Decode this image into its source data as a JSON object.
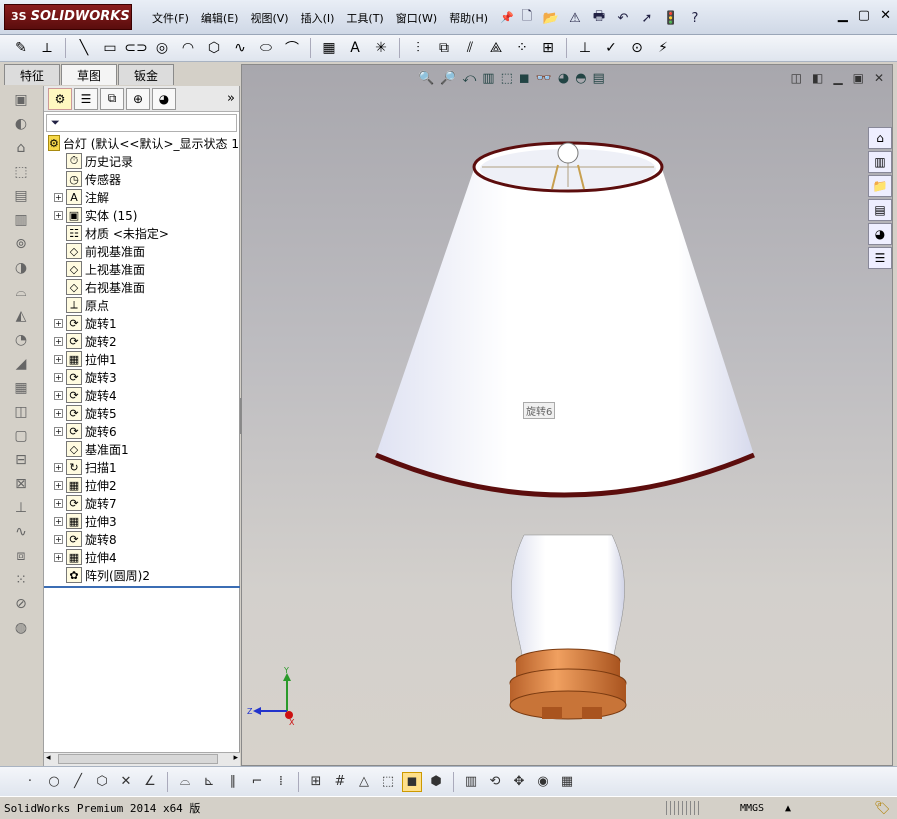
{
  "app": {
    "logo_prefix": "3S",
    "logo_text": "SOLIDWORKS",
    "menus": [
      "文件(F)",
      "编辑(E)",
      "视图(V)",
      "插入(I)",
      "工具(T)",
      "窗口(W)",
      "帮助(H)"
    ]
  },
  "tabs": [
    "特征",
    "草图",
    "钣金"
  ],
  "active_tab": "草图",
  "feature_tree": {
    "root_label": "台灯  (默认<<默认>_显示状态 1",
    "items": [
      {
        "label": "历史记录",
        "icon": "history-icon",
        "expandable": false
      },
      {
        "label": "传感器",
        "icon": "sensor-icon",
        "expandable": false
      },
      {
        "label": "注解",
        "icon": "annotation-icon",
        "expandable": true
      },
      {
        "label": "实体 (15)",
        "icon": "solid-bodies-icon",
        "expandable": true
      },
      {
        "label": "材质 <未指定>",
        "icon": "material-icon",
        "expandable": false
      },
      {
        "label": "前视基准面",
        "icon": "plane-icon",
        "expandable": false
      },
      {
        "label": "上视基准面",
        "icon": "plane-icon",
        "expandable": false
      },
      {
        "label": "右视基准面",
        "icon": "plane-icon",
        "expandable": false
      },
      {
        "label": "原点",
        "icon": "origin-icon",
        "expandable": false
      },
      {
        "label": "旋转1",
        "icon": "revolve-icon",
        "expandable": true
      },
      {
        "label": "旋转2",
        "icon": "revolve-icon",
        "expandable": true
      },
      {
        "label": "拉伸1",
        "icon": "extrude-icon",
        "expandable": true
      },
      {
        "label": "旋转3",
        "icon": "revolve-icon",
        "expandable": true
      },
      {
        "label": "旋转4",
        "icon": "revolve-icon",
        "expandable": true
      },
      {
        "label": "旋转5",
        "icon": "revolve-icon",
        "expandable": true
      },
      {
        "label": "旋转6",
        "icon": "revolve-icon",
        "expandable": true
      },
      {
        "label": "基准面1",
        "icon": "plane-icon",
        "expandable": false
      },
      {
        "label": "扫描1",
        "icon": "sweep-icon",
        "expandable": true
      },
      {
        "label": "拉伸2",
        "icon": "extrude-icon",
        "expandable": true
      },
      {
        "label": "旋转7",
        "icon": "revolve-icon",
        "expandable": true
      },
      {
        "label": "拉伸3",
        "icon": "extrude-icon",
        "expandable": true
      },
      {
        "label": "旋转8",
        "icon": "revolve-icon",
        "expandable": true
      },
      {
        "label": "拉伸4",
        "icon": "extrude-icon",
        "expandable": true
      },
      {
        "label": "阵列(圆周)2",
        "icon": "circular-pattern-icon",
        "expandable": false
      }
    ]
  },
  "graphics": {
    "tooltip_label": "旋转6",
    "triad_labels": {
      "y": "Y",
      "z": "Z",
      "x": "X"
    }
  },
  "status_bar": {
    "text": "SolidWorks Premium 2014 x64 版",
    "units": "MMGS",
    "units_arrow": "▲"
  },
  "colors": {
    "lamp_shade": "#ffffff",
    "shade_rim": "#6b1010",
    "base_wood": "#d8884a",
    "vase_body": "#ffffff"
  }
}
